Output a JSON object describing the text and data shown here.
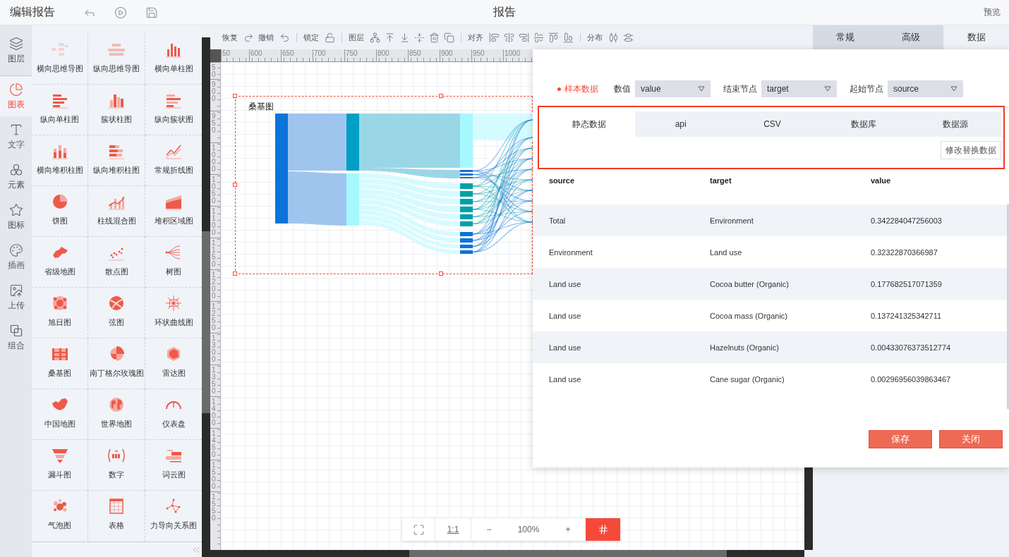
{
  "header": {
    "title": "编辑报告",
    "center_title": "报告",
    "preview": "预览"
  },
  "rail": [
    {
      "label": "图层",
      "selected": false
    },
    {
      "label": "图表",
      "selected": true
    },
    {
      "label": "文字",
      "selected": false
    },
    {
      "label": "元素",
      "selected": false
    },
    {
      "label": "图标",
      "selected": false
    },
    {
      "label": "插画",
      "selected": false
    },
    {
      "label": "上传",
      "selected": false
    },
    {
      "label": "组合",
      "selected": false
    }
  ],
  "palette": [
    {
      "label": "横向思维导图"
    },
    {
      "label": "纵向思维导图"
    },
    {
      "label": "横向单柱图"
    },
    {
      "label": "纵向单柱图"
    },
    {
      "label": "簇状柱图"
    },
    {
      "label": "纵向簇状图"
    },
    {
      "label": "横向堆积柱图"
    },
    {
      "label": "纵向堆积柱图"
    },
    {
      "label": "常规折线图"
    },
    {
      "label": "饼图"
    },
    {
      "label": "柱线混合图"
    },
    {
      "label": "堆积区域图"
    },
    {
      "label": "省级地图"
    },
    {
      "label": "散点图"
    },
    {
      "label": "树图"
    },
    {
      "label": "旭日图"
    },
    {
      "label": "弦图"
    },
    {
      "label": "环状曲线图"
    },
    {
      "label": "桑基图"
    },
    {
      "label": "南丁格尔玫瑰图"
    },
    {
      "label": "雷达图"
    },
    {
      "label": "中国地图"
    },
    {
      "label": "世界地图"
    },
    {
      "label": "仪表盘"
    },
    {
      "label": "漏斗图"
    },
    {
      "label": "数字"
    },
    {
      "label": "词云图"
    },
    {
      "label": "气泡图"
    },
    {
      "label": "表格"
    },
    {
      "label": "力导向关系图"
    }
  ],
  "toolbar": [
    {
      "label": "恢复"
    },
    {
      "label": "撤销"
    },
    {
      "label": "锁定"
    },
    {
      "label": "图层"
    },
    {
      "label": "对齐"
    },
    {
      "label": "分布"
    }
  ],
  "h_ruler": [
    "50",
    "600",
    "650",
    "700",
    "750",
    "800",
    "850",
    "900",
    "950",
    "1000"
  ],
  "v_ruler": [
    "50",
    "900",
    "950",
    "1000",
    "1050",
    "1100",
    "1150",
    "1200",
    "1250",
    "1300",
    "1350",
    "1400",
    "1450",
    "1500",
    "1550"
  ],
  "chart": {
    "title": "桑基图",
    "selected": true
  },
  "zoom": {
    "reset": "1:1",
    "minus": "−",
    "level": "100%",
    "plus": "+",
    "grid_on": true
  },
  "panel_tabs": [
    {
      "label": "常规",
      "selected": false
    },
    {
      "label": "高级",
      "selected": false
    },
    {
      "label": "数据",
      "selected": true
    }
  ],
  "data_dialog": {
    "sample": "样本数据",
    "fields": [
      {
        "label": "数值",
        "value": "value"
      },
      {
        "label": "结束节点",
        "value": "target"
      },
      {
        "label": "起始节点",
        "value": "source"
      }
    ],
    "source_tabs": [
      {
        "label": "静态数据",
        "selected": true
      },
      {
        "label": "api",
        "selected": false
      },
      {
        "label": "CSV",
        "selected": false
      },
      {
        "label": "数据库",
        "selected": false
      },
      {
        "label": "数据源",
        "selected": false
      }
    ],
    "replace_button": "修改替换数据",
    "columns": [
      "source",
      "target",
      "value"
    ],
    "rows": [
      [
        "Total",
        "Environment",
        "0.342284047256003"
      ],
      [
        "Environment",
        "Land use",
        "0.32322870366987"
      ],
      [
        "Land use",
        "Cocoa butter (Organic)",
        "0.177682517071359"
      ],
      [
        "Land use",
        "Cocoa mass (Organic)",
        "0.137241325342711"
      ],
      [
        "Land use",
        "Hazelnuts (Organic)",
        "0.00433076373512774"
      ],
      [
        "Land use",
        "Cane sugar (Organic)",
        "0.00296956039863467"
      ]
    ],
    "buttons": [
      {
        "label": "保存"
      },
      {
        "label": "关闭"
      }
    ]
  }
}
